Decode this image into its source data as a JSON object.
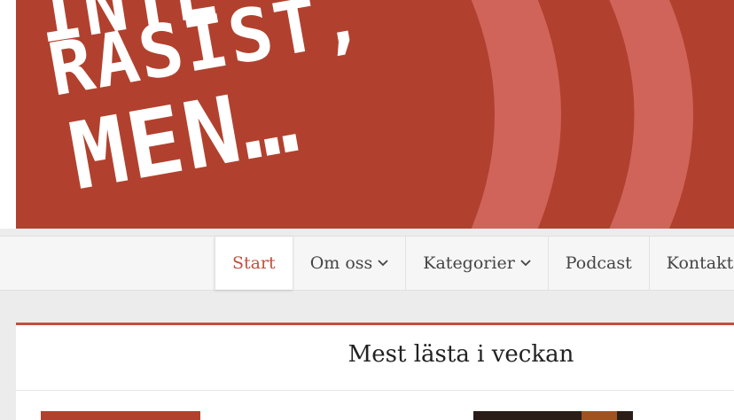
{
  "banner": {
    "logo_line1": "INTE",
    "logo_line2": "RASIST,",
    "logo_line3": "MEN…",
    "background_color": "#b1412e",
    "arc_color": "#d0645a"
  },
  "nav": {
    "items": [
      {
        "label": "Start",
        "active": true,
        "has_dropdown": false
      },
      {
        "label": "Om oss",
        "active": false,
        "has_dropdown": true
      },
      {
        "label": "Kategorier",
        "active": false,
        "has_dropdown": true
      },
      {
        "label": "Podcast",
        "active": false,
        "has_dropdown": false
      },
      {
        "label": "Kontakt",
        "active": false,
        "has_dropdown": true
      }
    ],
    "active_color": "#c0513c",
    "dropdown_icon": "chevron-down-icon"
  },
  "widget": {
    "title": "Mest lästa i veckan",
    "accent_color": "#c0513c"
  }
}
